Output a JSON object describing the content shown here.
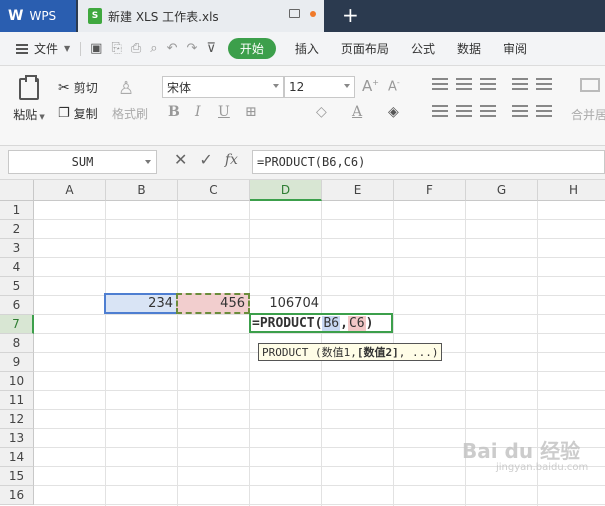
{
  "titlebar": {
    "app_name": "WPS",
    "doc_title": "新建 XLS 工作表.xls",
    "new_tab": "+"
  },
  "menubar": {
    "file": "文件",
    "tabs": [
      "开始",
      "插入",
      "页面布局",
      "公式",
      "数据",
      "审阅"
    ]
  },
  "ribbon": {
    "paste": "粘贴",
    "cut": "剪切",
    "copy": "复制",
    "format_painter": "格式刷",
    "font_name": "宋体",
    "font_size": "12",
    "merge": "合并居"
  },
  "formula_bar": {
    "name_box": "SUM",
    "fx": "fx",
    "formula": "=PRODUCT(B6,C6)"
  },
  "grid": {
    "columns": [
      "A",
      "B",
      "C",
      "D",
      "E",
      "F",
      "G",
      "H"
    ],
    "rows": [
      "1",
      "2",
      "3",
      "4",
      "5",
      "6",
      "7",
      "8",
      "9",
      "10",
      "11",
      "12",
      "13",
      "14",
      "15",
      "16"
    ],
    "b6": "234",
    "c6": "456",
    "d6": "106704",
    "edit": {
      "fn": "=PRODUCT(",
      "ref1": "B6",
      ",": ",",
      "ref2": "C6",
      "close": ")"
    },
    "tooltip": {
      "pre": "PRODUCT (数值1, ",
      "bold": "[数值2]",
      "post": ", ...)"
    }
  },
  "watermark": {
    "text": "Bai du 经验",
    "sub": "jingyan.baidu.com"
  }
}
